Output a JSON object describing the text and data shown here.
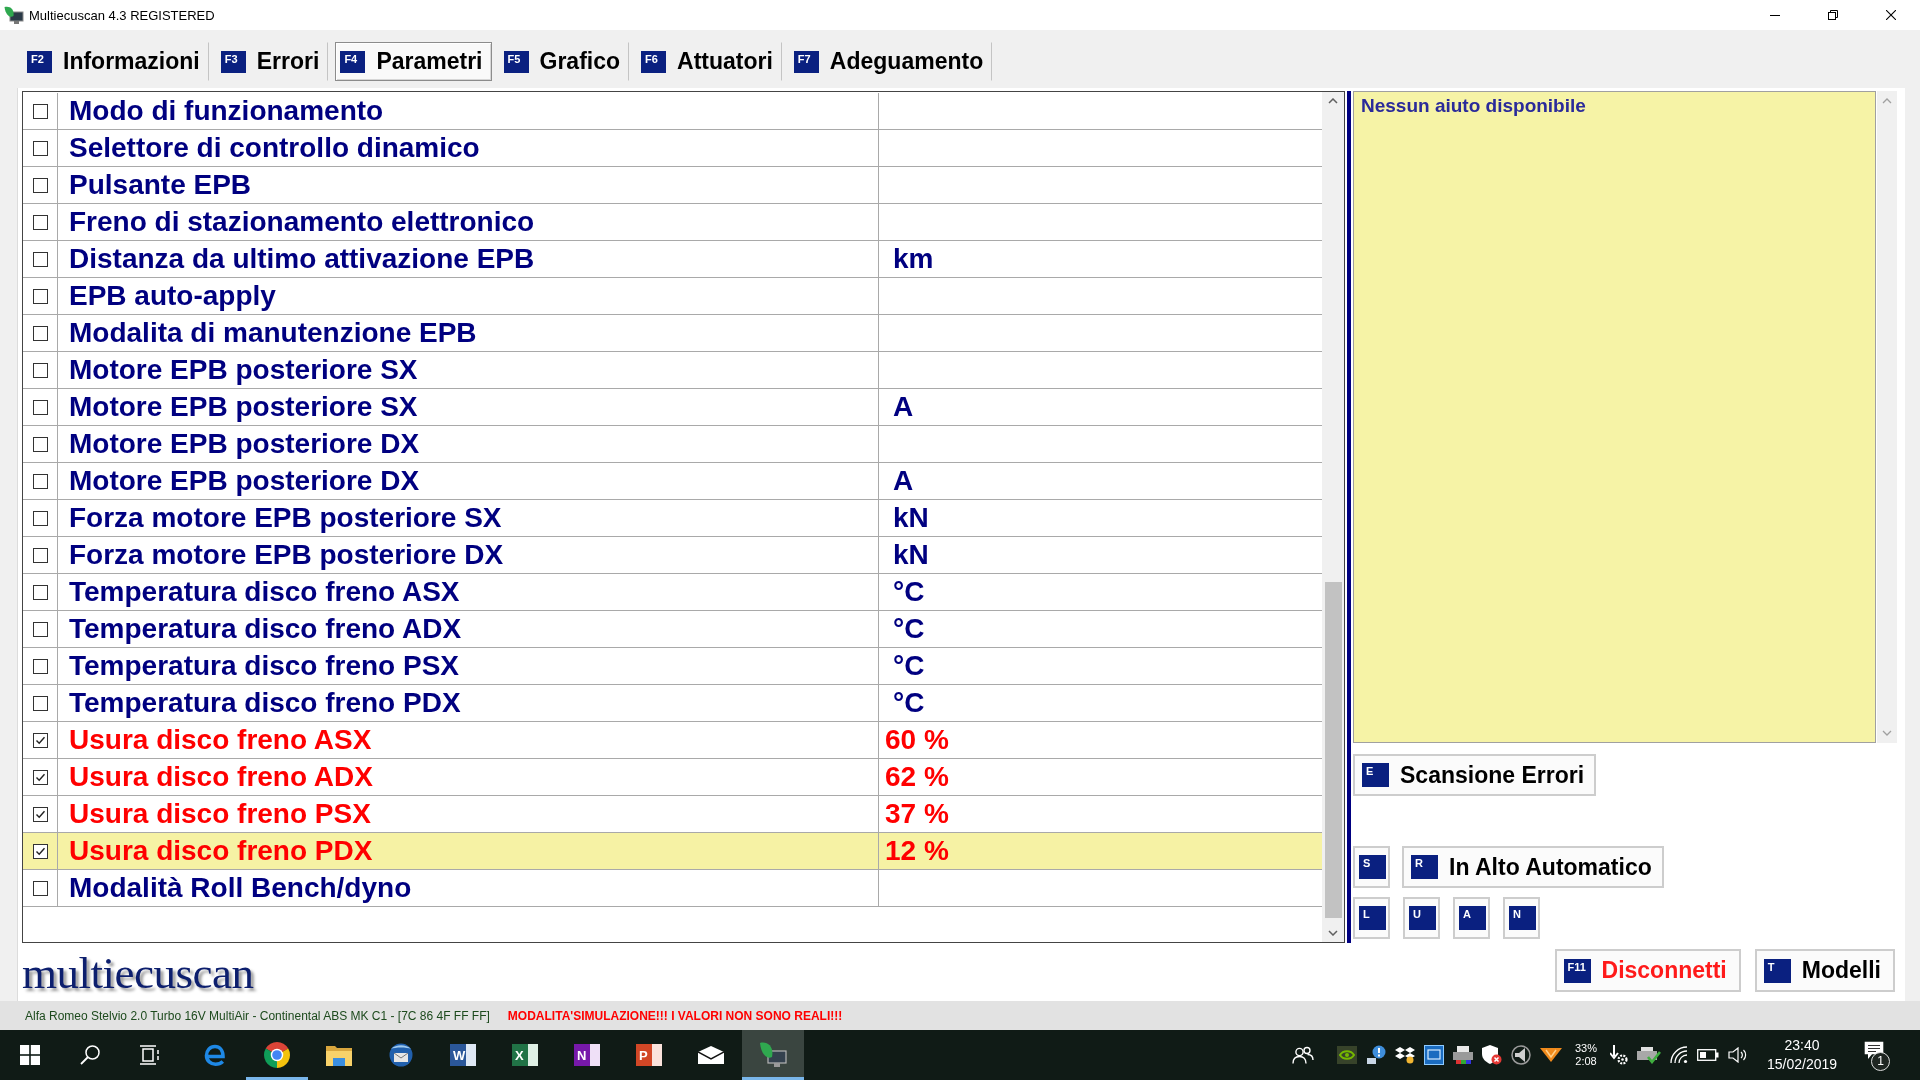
{
  "window": {
    "title": "Multiecuscan 4.3 REGISTERED"
  },
  "tabs": [
    {
      "key": "F2",
      "label": "Informazioni",
      "selected": false
    },
    {
      "key": "F3",
      "label": "Errori",
      "selected": false
    },
    {
      "key": "F4",
      "label": "Parametri",
      "selected": true
    },
    {
      "key": "F5",
      "label": "Grafico",
      "selected": false
    },
    {
      "key": "F6",
      "label": "Attuatori",
      "selected": false
    },
    {
      "key": "F7",
      "label": "Adeguamento",
      "selected": false
    }
  ],
  "parameters": {
    "rows": [
      {
        "name": "Modo di funzionamento",
        "checked": false,
        "selected": false
      },
      {
        "name": "Selettore di controllo dinamico",
        "checked": false,
        "selected": false
      },
      {
        "name": "Pulsante EPB",
        "checked": false,
        "selected": false
      },
      {
        "name": "Freno di stazionamento elettronico",
        "checked": false,
        "selected": false
      },
      {
        "name": "Distanza da ultimo attivazione EPB",
        "value": "km",
        "checked": false,
        "selected": false
      },
      {
        "name": "EPB auto-apply",
        "checked": false,
        "selected": false
      },
      {
        "name": "Modalita di manutenzione EPB",
        "checked": false,
        "selected": false
      },
      {
        "name": "Motore EPB posteriore SX",
        "checked": false,
        "selected": false
      },
      {
        "name": "Motore EPB posteriore SX",
        "value": "A",
        "checked": false,
        "selected": false
      },
      {
        "name": "Motore EPB posteriore DX",
        "checked": false,
        "selected": false
      },
      {
        "name": "Motore EPB posteriore DX",
        "value": "A",
        "checked": false,
        "selected": false
      },
      {
        "name": "Forza motore EPB posteriore SX",
        "value": "kN",
        "checked": false,
        "selected": false
      },
      {
        "name": "Forza motore EPB posteriore DX",
        "value": "kN",
        "checked": false,
        "selected": false
      },
      {
        "name": "Temperatura disco freno ASX",
        "value": "°C",
        "checked": false,
        "selected": false
      },
      {
        "name": "Temperatura disco freno ADX",
        "value": "°C",
        "checked": false,
        "selected": false
      },
      {
        "name": "Temperatura disco freno PSX",
        "value": "°C",
        "checked": false,
        "selected": false
      },
      {
        "name": "Temperatura disco freno PDX",
        "value": "°C",
        "checked": false,
        "selected": false
      },
      {
        "name": "Usura disco freno ASX",
        "value": "60 %",
        "checked": true,
        "selected": false
      },
      {
        "name": "Usura disco freno ADX",
        "value": "62 %",
        "checked": true,
        "selected": false
      },
      {
        "name": "Usura disco freno PSX",
        "value": "37 %",
        "checked": true,
        "selected": false
      },
      {
        "name": "Usura disco freno PDX",
        "value": "12 %",
        "checked": true,
        "selected": true
      },
      {
        "name": "Modalità Roll Bench/dyno",
        "checked": false,
        "selected": false
      }
    ]
  },
  "help": {
    "text": "Nessun aiuto disponibile"
  },
  "side_buttons": {
    "scan": {
      "key": "E",
      "label": "Scansione Errori"
    },
    "stop": {
      "key": "S"
    },
    "auto_up": {
      "key": "R",
      "label": "In Alto Automatico"
    },
    "keys": [
      {
        "key": "L"
      },
      {
        "key": "U"
      },
      {
        "key": "A"
      },
      {
        "key": "N"
      }
    ]
  },
  "footer": {
    "logo": "multiecuscan",
    "buttons": [
      {
        "key": "F11",
        "label": "Disconnetti",
        "kind": "danger"
      },
      {
        "key": "T",
        "label": "Modelli",
        "kind": "normal"
      }
    ]
  },
  "status_bar": {
    "vehicle": "Alfa Romeo Stelvio 2.0 Turbo 16V MultiAir - Continental ABS MK C1 - [7C 86 4F FF FF]",
    "warning": "MODALITA'SIMULAZIONE!!! I VALORI NON SONO REALI!!!"
  },
  "taskbar": {
    "system": [
      {
        "kind": "start"
      },
      {
        "kind": "search"
      },
      {
        "kind": "task-view"
      }
    ],
    "apps": [
      {
        "kind": "edge",
        "running": false,
        "selected": false
      },
      {
        "kind": "chrome",
        "running": true,
        "selected": false
      },
      {
        "kind": "explorer",
        "running": false,
        "selected": false
      },
      {
        "kind": "thunderbird",
        "running": false,
        "selected": false
      },
      {
        "kind": "word",
        "glyph": "W",
        "running": false,
        "selected": false
      },
      {
        "kind": "excel",
        "glyph": "X",
        "running": false,
        "selected": false
      },
      {
        "kind": "onenote",
        "glyph": "N",
        "running": false,
        "selected": false
      },
      {
        "kind": "powerpoint",
        "glyph": "P",
        "running": false,
        "selected": false
      },
      {
        "kind": "mail",
        "running": false,
        "selected": false
      },
      {
        "kind": "multiecuscan",
        "running": true,
        "selected": true
      }
    ],
    "tray": {
      "battery_percent": "33%",
      "battery_time": "2:08",
      "time": "23:40",
      "date": "15/02/2019",
      "notifications": "1"
    }
  }
}
